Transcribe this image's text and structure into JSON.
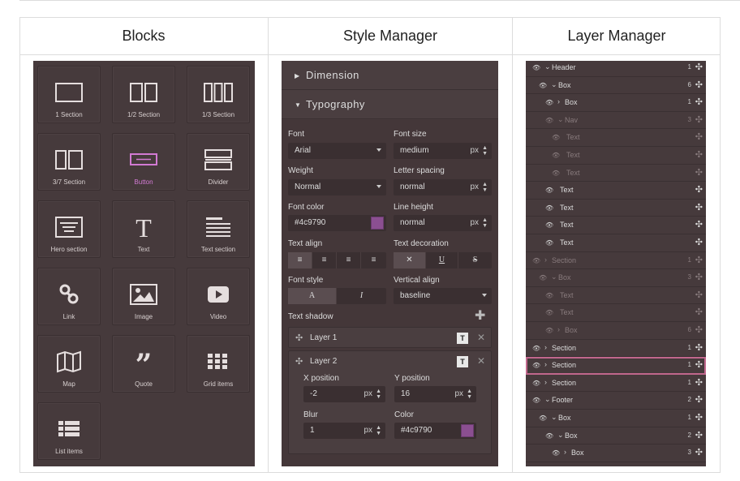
{
  "columns": {
    "blocks_title": "Blocks",
    "style_title": "Style Manager",
    "layer_title": "Layer Manager"
  },
  "blocks": [
    {
      "label": "1 Section",
      "icon": "one-section-icon"
    },
    {
      "label": "1/2 Section",
      "icon": "half-section-icon"
    },
    {
      "label": "1/3 Section",
      "icon": "third-section-icon"
    },
    {
      "label": "3/7 Section",
      "icon": "three-seven-section-icon"
    },
    {
      "label": "Button",
      "icon": "button-icon",
      "active": true
    },
    {
      "label": "Divider",
      "icon": "divider-icon"
    },
    {
      "label": "Hero section",
      "icon": "hero-section-icon"
    },
    {
      "label": "Text",
      "icon": "text-icon"
    },
    {
      "label": "Text section",
      "icon": "text-section-icon"
    },
    {
      "label": "Link",
      "icon": "link-icon"
    },
    {
      "label": "Image",
      "icon": "image-icon"
    },
    {
      "label": "Video",
      "icon": "video-icon"
    },
    {
      "label": "Map",
      "icon": "map-icon"
    },
    {
      "label": "Quote",
      "icon": "quote-icon"
    },
    {
      "label": "Grid items",
      "icon": "grid-items-icon"
    },
    {
      "label": "List items",
      "icon": "list-items-icon"
    }
  ],
  "style": {
    "sector_dimension": "Dimension",
    "sector_typography": "Typography",
    "font_label": "Font",
    "font_value": "Arial",
    "font_size_label": "Font size",
    "font_size_value": "medium",
    "font_size_unit": "px",
    "weight_label": "Weight",
    "weight_value": "Normal",
    "letter_spacing_label": "Letter spacing",
    "letter_spacing_value": "normal",
    "letter_spacing_unit": "px",
    "font_color_label": "Font color",
    "font_color_value": "#4c9790",
    "line_height_label": "Line height",
    "line_height_value": "normal",
    "line_height_unit": "px",
    "text_align_label": "Text align",
    "text_decoration_label": "Text decoration",
    "decoration_none": "✕",
    "decoration_underline": "U",
    "decoration_strike": "S",
    "font_style_label": "Font style",
    "font_style_normal": "A",
    "font_style_italic": "I",
    "vertical_align_label": "Vertical align",
    "vertical_align_value": "baseline",
    "text_shadow_label": "Text shadow",
    "layer1_name": "Layer 1",
    "layer2_name": "Layer 2",
    "x_position_label": "X position",
    "x_position_value": "-2",
    "x_position_unit": "px",
    "y_position_label": "Y position",
    "y_position_value": "16",
    "y_position_unit": "px",
    "blur_label": "Blur",
    "blur_value": "1",
    "blur_unit": "px",
    "color_label": "Color",
    "color_value": "#4c9790",
    "swatch_color": "#8b4f91"
  },
  "layers": [
    {
      "name": "Header",
      "count": "1",
      "depth": 0,
      "chev": "v",
      "dim": false
    },
    {
      "name": "Box",
      "count": "6",
      "depth": 1,
      "chev": "v",
      "dim": false
    },
    {
      "name": "Box",
      "count": "1",
      "depth": 2,
      "chev": ">",
      "dim": false
    },
    {
      "name": "Nav",
      "count": "3",
      "depth": 2,
      "chev": "v",
      "dim": true
    },
    {
      "name": "Text",
      "count": "",
      "depth": 3,
      "chev": "",
      "dim": true
    },
    {
      "name": "Text",
      "count": "",
      "depth": 3,
      "chev": "",
      "dim": true
    },
    {
      "name": "Text",
      "count": "",
      "depth": 3,
      "chev": "",
      "dim": true
    },
    {
      "name": "Text",
      "count": "",
      "depth": 2,
      "chev": "",
      "dim": false
    },
    {
      "name": "Text",
      "count": "",
      "depth": 2,
      "chev": "",
      "dim": false
    },
    {
      "name": "Text",
      "count": "",
      "depth": 2,
      "chev": "",
      "dim": false
    },
    {
      "name": "Text",
      "count": "",
      "depth": 2,
      "chev": "",
      "dim": false
    },
    {
      "name": "Section",
      "count": "1",
      "depth": 0,
      "chev": ">",
      "dim": true
    },
    {
      "name": "Box",
      "count": "3",
      "depth": 1,
      "chev": "v",
      "dim": true
    },
    {
      "name": "Text",
      "count": "",
      "depth": 2,
      "chev": "",
      "dim": true
    },
    {
      "name": "Text",
      "count": "",
      "depth": 2,
      "chev": "",
      "dim": true
    },
    {
      "name": "Box",
      "count": "6",
      "depth": 2,
      "chev": ">",
      "dim": true
    },
    {
      "name": "Section",
      "count": "1",
      "depth": 0,
      "chev": ">",
      "dim": false
    },
    {
      "name": "Section",
      "count": "1",
      "depth": 0,
      "chev": ">",
      "dim": false,
      "selected": true
    },
    {
      "name": "Section",
      "count": "1",
      "depth": 0,
      "chev": ">",
      "dim": false
    },
    {
      "name": "Footer",
      "count": "2",
      "depth": 0,
      "chev": "v",
      "dim": false
    },
    {
      "name": "Box",
      "count": "1",
      "depth": 1,
      "chev": "v",
      "dim": false
    },
    {
      "name": "Box",
      "count": "2",
      "depth": 2,
      "chev": "v",
      "dim": false
    },
    {
      "name": "Box",
      "count": "3",
      "depth": 3,
      "chev": ">",
      "dim": false
    }
  ]
}
